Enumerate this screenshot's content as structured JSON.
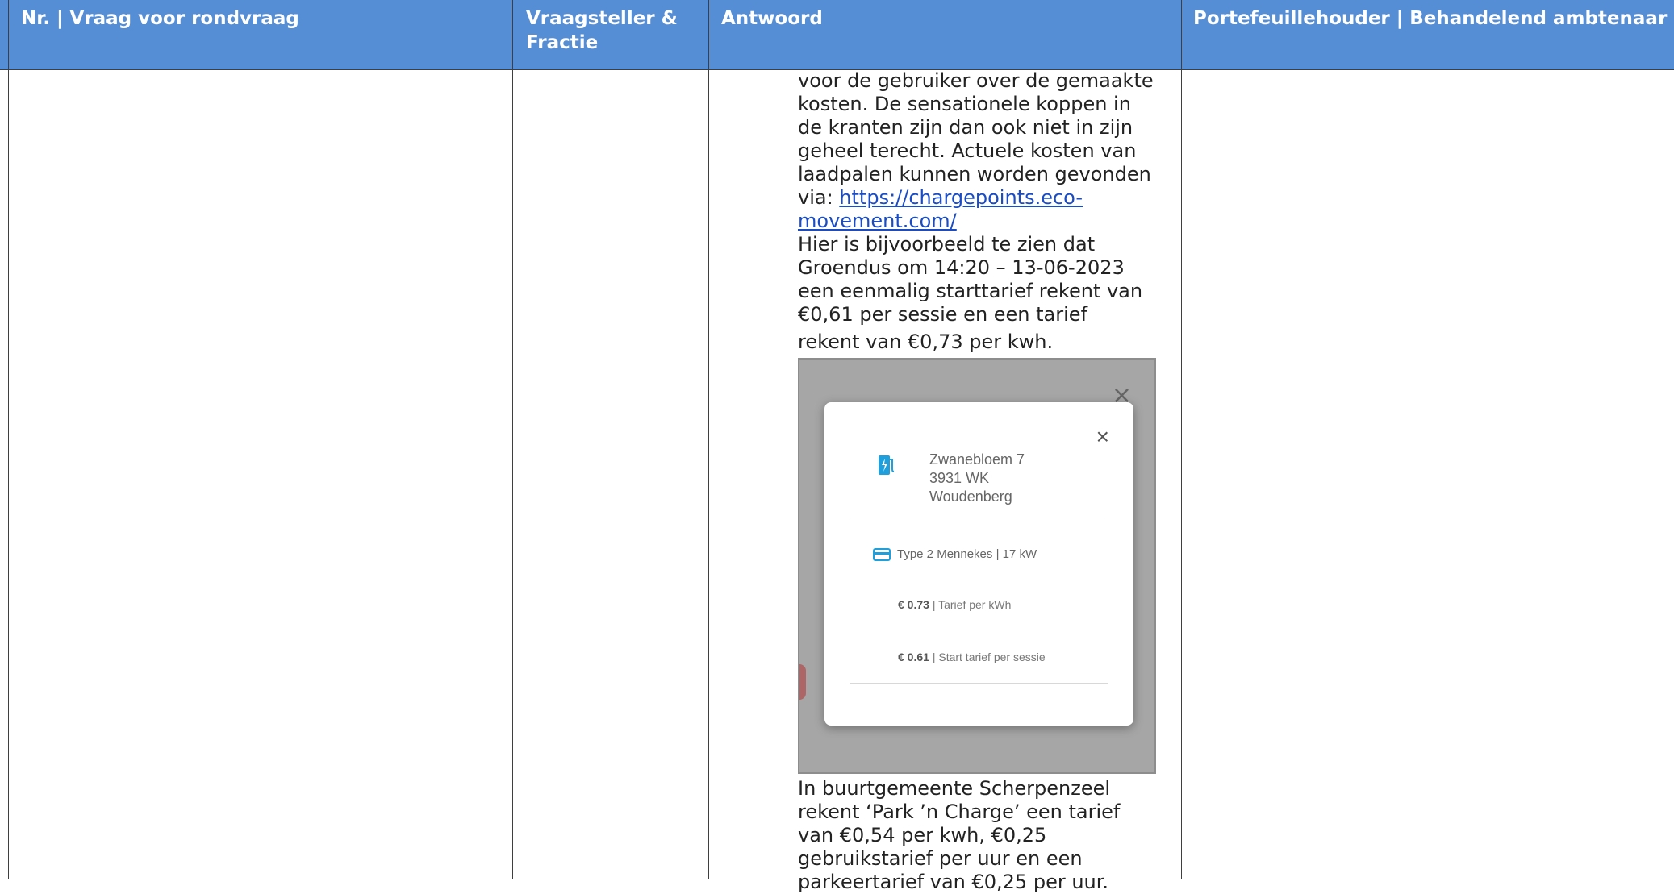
{
  "table": {
    "headers": [
      "Nr. | Vraag voor rondvraag",
      "Vraagsteller & Fractie",
      "Antwoord",
      "Portefeuillehouder | Behandelend ambtenaar"
    ]
  },
  "answer": {
    "para1": "voor de gebruiker over de gemaakte kosten. De sensationele koppen in de kranten zijn dan ook niet in zijn geheel terecht. Actuele kosten van laadpalen kunnen worden gevonden via: ",
    "link": "https://chargepoints.eco-movement.com/",
    "para2": "Hier is bijvoorbeeld te zien dat Groendus om 14:20 – 13-06-2023 een eenmalig starttarief rekent van €0,61 per sessie en een tarief",
    "para3": "rekent van €0,73 per kwh.",
    "para4": "In buurtgemeente Scherpenzeel rekent ‘Park ’n Charge’ een tarief van €0,54 per kwh, €0,25 gebruikstarief per uur en een parkeertarief van €0,25 per uur."
  },
  "screenshot": {
    "close_glyph": "×",
    "address_line1": "Zwanebloem 7",
    "address_line2": "3931 WK",
    "address_line3": "Woudenberg",
    "connector": "Type 2 Mennekes  |   17 kW",
    "price_kwh_value": "€ 0.73",
    "price_kwh_label": " | Tarief per kWh",
    "price_start_value": "€ 0.61",
    "price_start_label": " | Start tarief per sessie",
    "icon_color": "#1fa0dc"
  },
  "colors": {
    "header_bg": "#558ed5",
    "header_text": "#ffffff",
    "link": "#1a4cc4"
  }
}
